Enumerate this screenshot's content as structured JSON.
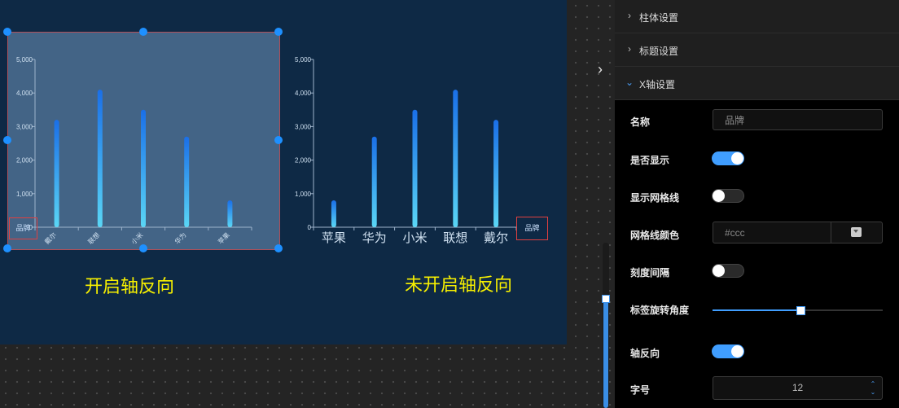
{
  "canvas": {
    "captions": {
      "left": "开启轴反向",
      "right": "未开启轴反向"
    }
  },
  "chart_data": [
    {
      "type": "bar",
      "categories": [
        "戴尔",
        "联想",
        "小米",
        "华为",
        "苹果"
      ],
      "values": [
        3200,
        4100,
        3500,
        2700,
        800
      ],
      "ylim": [
        0,
        5000
      ],
      "yticks": [
        "0",
        "1,000",
        "2,000",
        "3,000",
        "4,000",
        "5,000"
      ],
      "xaxis_name": "品牌",
      "x_inverse": true,
      "bar_colors": [
        "#1a6fe8",
        "#5ad6f5"
      ]
    },
    {
      "type": "bar",
      "categories": [
        "苹果",
        "华为",
        "小米",
        "联想",
        "戴尔"
      ],
      "values": [
        800,
        2700,
        3500,
        4100,
        3200
      ],
      "ylim": [
        0,
        5000
      ],
      "yticks": [
        "0",
        "1,000",
        "2,000",
        "3,000",
        "4,000",
        "5,000"
      ],
      "xaxis_name": "品牌",
      "x_inverse": false,
      "bar_colors": [
        "#1a6fe8",
        "#5ad6f5"
      ]
    }
  ],
  "panel": {
    "sections": {
      "bar": "柱体设置",
      "title": "标题设置",
      "xaxis": "X轴设置"
    },
    "props": {
      "name_label": "名称",
      "name_value": "品牌",
      "show_label": "是否显示",
      "grid_label": "显示网格线",
      "grid_color_label": "网格线颜色",
      "grid_color_value": "#ccc",
      "tick_interval_label": "刻度间隔",
      "rotate_label": "标签旋转角度",
      "rotate_fraction": 0.52,
      "inverse_label": "轴反向",
      "font_size_label": "字号",
      "font_size_value": "12"
    },
    "colors": {
      "accent": "#409eff",
      "caption": "#f7f000"
    },
    "icons": {
      "collapse": "chevron-right-icon",
      "section_closed": "chevron-right-icon",
      "section_open": "chevron-down-icon"
    }
  }
}
